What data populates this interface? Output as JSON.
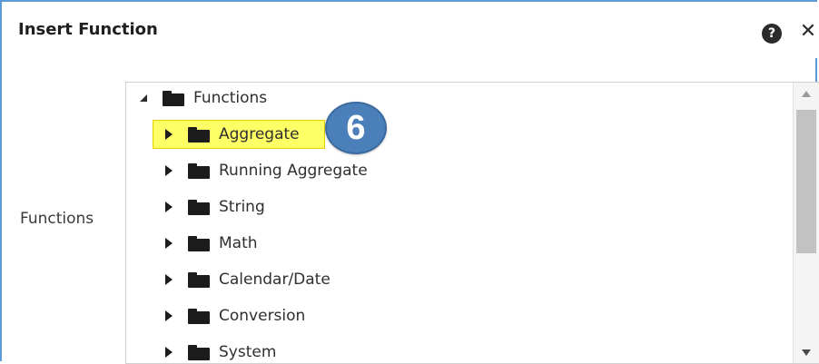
{
  "dialog": {
    "title": "Insert Function",
    "help_icon": "?",
    "close_icon": "✕"
  },
  "form": {
    "functions_label": "Functions"
  },
  "tree": {
    "root": {
      "label": "Functions",
      "expanded": true
    },
    "items": [
      {
        "label": "Aggregate",
        "selected": true
      },
      {
        "label": "Running Aggregate",
        "selected": false
      },
      {
        "label": "String",
        "selected": false
      },
      {
        "label": "Math",
        "selected": false
      },
      {
        "label": "Calendar/Date",
        "selected": false
      },
      {
        "label": "Conversion",
        "selected": false
      },
      {
        "label": "System",
        "selected": false
      }
    ]
  },
  "annotation": {
    "step_number": "6"
  },
  "colors": {
    "border": "#5b9bd5",
    "selected_highlight": "#ffff66",
    "badge": "#4a7fba"
  }
}
